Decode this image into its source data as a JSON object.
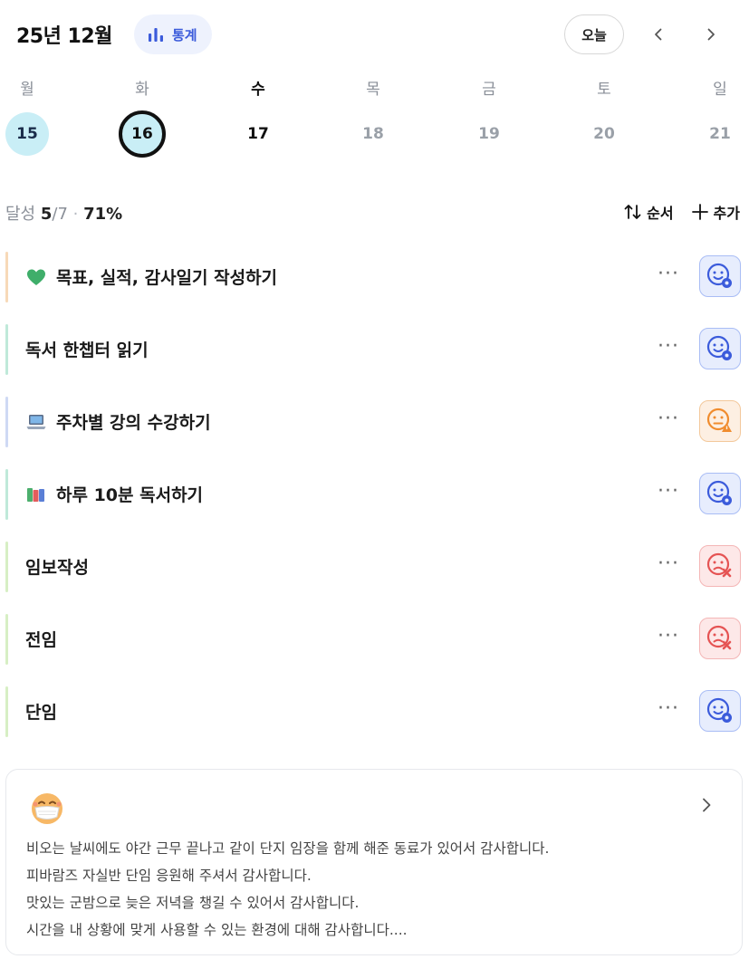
{
  "header": {
    "month_title": "25년 12월",
    "stats_label": "통계",
    "today_label": "오늘"
  },
  "week": {
    "days": [
      {
        "weekday": "월",
        "date": "15",
        "state": "done"
      },
      {
        "weekday": "화",
        "date": "16",
        "state": "today"
      },
      {
        "weekday": "수",
        "date": "17",
        "state": "plain"
      },
      {
        "weekday": "목",
        "date": "18",
        "state": "future"
      },
      {
        "weekday": "금",
        "date": "19",
        "state": "future"
      },
      {
        "weekday": "토",
        "date": "20",
        "state": "future"
      },
      {
        "weekday": "일",
        "date": "21",
        "state": "future"
      }
    ]
  },
  "summary": {
    "label": "달성",
    "done": "5",
    "total": "7",
    "percent": "71%",
    "order_label": "순서",
    "add_label": "추가"
  },
  "habits": [
    {
      "title": "목표, 실적, 감사일기 작성하기",
      "emoji": "green-heart-icon",
      "bar_color": "#f7d9b8",
      "status": "success"
    },
    {
      "title": "독서 한챕터 읽기",
      "emoji": "",
      "bar_color": "#bfe9d9",
      "status": "success"
    },
    {
      "title": "주차별 강의 수강하기",
      "emoji": "laptop-icon",
      "bar_color": "#cfd9f4",
      "status": "warn"
    },
    {
      "title": "하루 10분 독서하기",
      "emoji": "books-icon",
      "bar_color": "#bfe9d9",
      "status": "success"
    },
    {
      "title": "임보작성",
      "emoji": "",
      "bar_color": "#d7efc4",
      "status": "fail"
    },
    {
      "title": "전임",
      "emoji": "",
      "bar_color": "#d7efc4",
      "status": "fail"
    },
    {
      "title": "단임",
      "emoji": "",
      "bar_color": "#d7efc4",
      "status": "success"
    }
  ],
  "more_label": "···",
  "note": {
    "emoji": "face-with-mask-icon",
    "lines": [
      "비오는 날씨에도 야간 근무 끝나고 같이 단지 임장을 함께 해준 동료가 있어서 감사합니다.",
      "피바람즈 자실반 단임 응원해 주셔서 감사합니다.",
      "맛있는 군밤으로 늦은 저녁을 챙길 수 있어서 감사합니다.",
      "시간을 내 상황에 맞게 사용할 수 있는 환경에 대해 감사합니다...."
    ]
  },
  "colors": {
    "accent": "#3b5bdb",
    "done_fill": "#c9eef6",
    "success": "#3b5bdb",
    "warn": "#f08c2e",
    "fail": "#e55353"
  }
}
